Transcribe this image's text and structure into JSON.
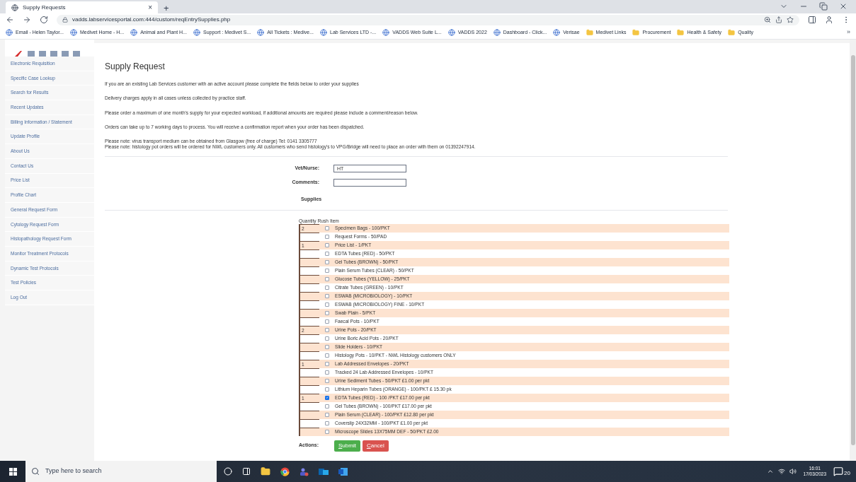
{
  "browser": {
    "tab": {
      "title": "Supply Requests",
      "close": "×"
    },
    "new_tab": "+",
    "url": "vadds.labservicesportal.com:444/custom/reqEntrySupplies.php",
    "bookmarks": [
      {
        "label": "Email - Helen Taylor...",
        "kind": "site"
      },
      {
        "label": "Medivet Home - H...",
        "kind": "site"
      },
      {
        "label": "Animal and Plant H...",
        "kind": "site"
      },
      {
        "label": "Support : Medivet S...",
        "kind": "site"
      },
      {
        "label": "All Tickets : Medive...",
        "kind": "site"
      },
      {
        "label": "Lab Services LTD -...",
        "kind": "site"
      },
      {
        "label": "VADDS Web Suite L...",
        "kind": "site"
      },
      {
        "label": "VADDS 2022",
        "kind": "site"
      },
      {
        "label": "Dashboard - Click...",
        "kind": "site"
      },
      {
        "label": "Verisae",
        "kind": "site"
      },
      {
        "label": "Medivet Links",
        "kind": "folder"
      },
      {
        "label": "Procurement",
        "kind": "folder"
      },
      {
        "label": "Health & Safety",
        "kind": "folder"
      },
      {
        "label": "Quality",
        "kind": "folder"
      }
    ],
    "more": "»"
  },
  "sidebar": {
    "items": [
      {
        "label": "Electronic Requisition"
      },
      {
        "label": "Specific Case Lookup"
      },
      {
        "label": "Search for Results"
      },
      {
        "label": "Recent Updates"
      },
      {
        "label": "Billing Information / Statement"
      },
      {
        "label": "Update Profile"
      },
      {
        "label": "About Us"
      },
      {
        "label": "Contact Us"
      },
      {
        "label": "Price List"
      },
      {
        "label": "Profile Chart"
      },
      {
        "label": "General Request Form"
      },
      {
        "label": "Cytology Request Form"
      },
      {
        "label": "Histopathology Request Form"
      },
      {
        "label": "Monitor Treatment Protocols"
      },
      {
        "label": "Dynamic Test Protocols"
      },
      {
        "label": "Test Policies"
      },
      {
        "label": "Log Out"
      }
    ]
  },
  "main": {
    "title": "Supply Request",
    "paragraphs": [
      "If you are an existing Lab Services customer with an active account please complete the fields below to order your supplies",
      "Delivery charges apply in all cases unless collected by practice staff.",
      "Please order a maximum of one month's supply for your expected workload, if additional amounts are required please include a comment/reason below.",
      "Orders can take up to 7 working days to process. You will receive a confirmation report when your order has been dispatched."
    ],
    "notes": [
      "Please note: virus transport medium can be obtained from Glasgow (free of charge) Tel: 0141 3305777",
      "Please note: histology pot orders will be ordered for NWL customers only. All customers who send histology's to VPG/Bridge will need to place an order with them on 01392247914."
    ],
    "form": {
      "fields": [
        {
          "label": "Vet/Nurse:",
          "value": "HT"
        },
        {
          "label": "Comments:"
        }
      ],
      "supplies_label": "Supplies",
      "columns": [
        "Quantity",
        "Rush",
        "Item"
      ],
      "rows": [
        {
          "quantity": "2",
          "checked": false,
          "item": "Specimen Bags - 100/PKT"
        },
        {
          "checked": false,
          "item": "Request Forms - 50/PAD"
        },
        {
          "quantity": "1",
          "checked": false,
          "item": "Price List - 1/PKT"
        },
        {
          "checked": false,
          "item": "EDTA Tubes (RED) - 50/PKT"
        },
        {
          "checked": false,
          "item": "Gel Tubes (BROWN) - 50/PKT"
        },
        {
          "checked": false,
          "item": "Plain Serum Tubes (CLEAR) - 50/PKT"
        },
        {
          "checked": false,
          "item": "Glucose Tubes (YELLOW) - 25/PKT"
        },
        {
          "checked": false,
          "item": "Citrate Tubes (GREEN) - 10/PKT"
        },
        {
          "checked": false,
          "item": "ESWAB (MICROBIOLOGY) - 10/PKT"
        },
        {
          "checked": false,
          "item": "ESWAB (MICROBIOLOGY) FINE - 10/PKT"
        },
        {
          "checked": false,
          "item": "Swab Plain - 5/PKT"
        },
        {
          "checked": false,
          "item": "Faecal Pots - 10/PKT"
        },
        {
          "quantity": "2",
          "checked": false,
          "item": "Urine Pots - 20/PKT"
        },
        {
          "checked": false,
          "item": "Urine Boric Acid Pots - 20/PKT"
        },
        {
          "checked": false,
          "item": "Slide Holders - 10/PKT"
        },
        {
          "checked": false,
          "item": "Histology Pots - 10/PKT - NWL Histology customers ONLY"
        },
        {
          "quantity": "1",
          "checked": false,
          "item": "Lab Addressed Envelopes - 20/PKT"
        },
        {
          "checked": false,
          "item": "Tracked 24 Lab Addressed Envelopes - 10/PKT"
        },
        {
          "checked": false,
          "item": "Urine Sediment Tubes - 50/PKT £1.00 per pkt"
        },
        {
          "checked": false,
          "item": "Lithium Heparin Tubes (ORANGE) - 100/PKT £ 15.30 pk"
        },
        {
          "quantity": "1",
          "checked": true,
          "item": "EDTA Tubes (RED) - 100 /PKT £17.00 per pkt"
        },
        {
          "checked": false,
          "item": "Gel Tubes (BROWN) - 100/PKT £17.00 per pkt"
        },
        {
          "checked": false,
          "item": "Plain Serum (CLEAR) - 100/PKT £12.80 per pkt"
        },
        {
          "checked": false,
          "item": "Coverslip 24X32MM - 100/PKT £1.00 per pkt"
        },
        {
          "checked": false,
          "item": "Microscope Slides 13X75MM DEF - 50/PKT £2.00"
        }
      ],
      "actions_label": "Actions:",
      "buttons": [
        {
          "label": "Submit",
          "kind": "submit"
        },
        {
          "label": "Cancel",
          "kind": "cancel"
        }
      ]
    }
  },
  "taskbar": {
    "search_placeholder": "Type here to search",
    "time": "16:01",
    "date": "17/03/2023",
    "notifications": "20"
  }
}
